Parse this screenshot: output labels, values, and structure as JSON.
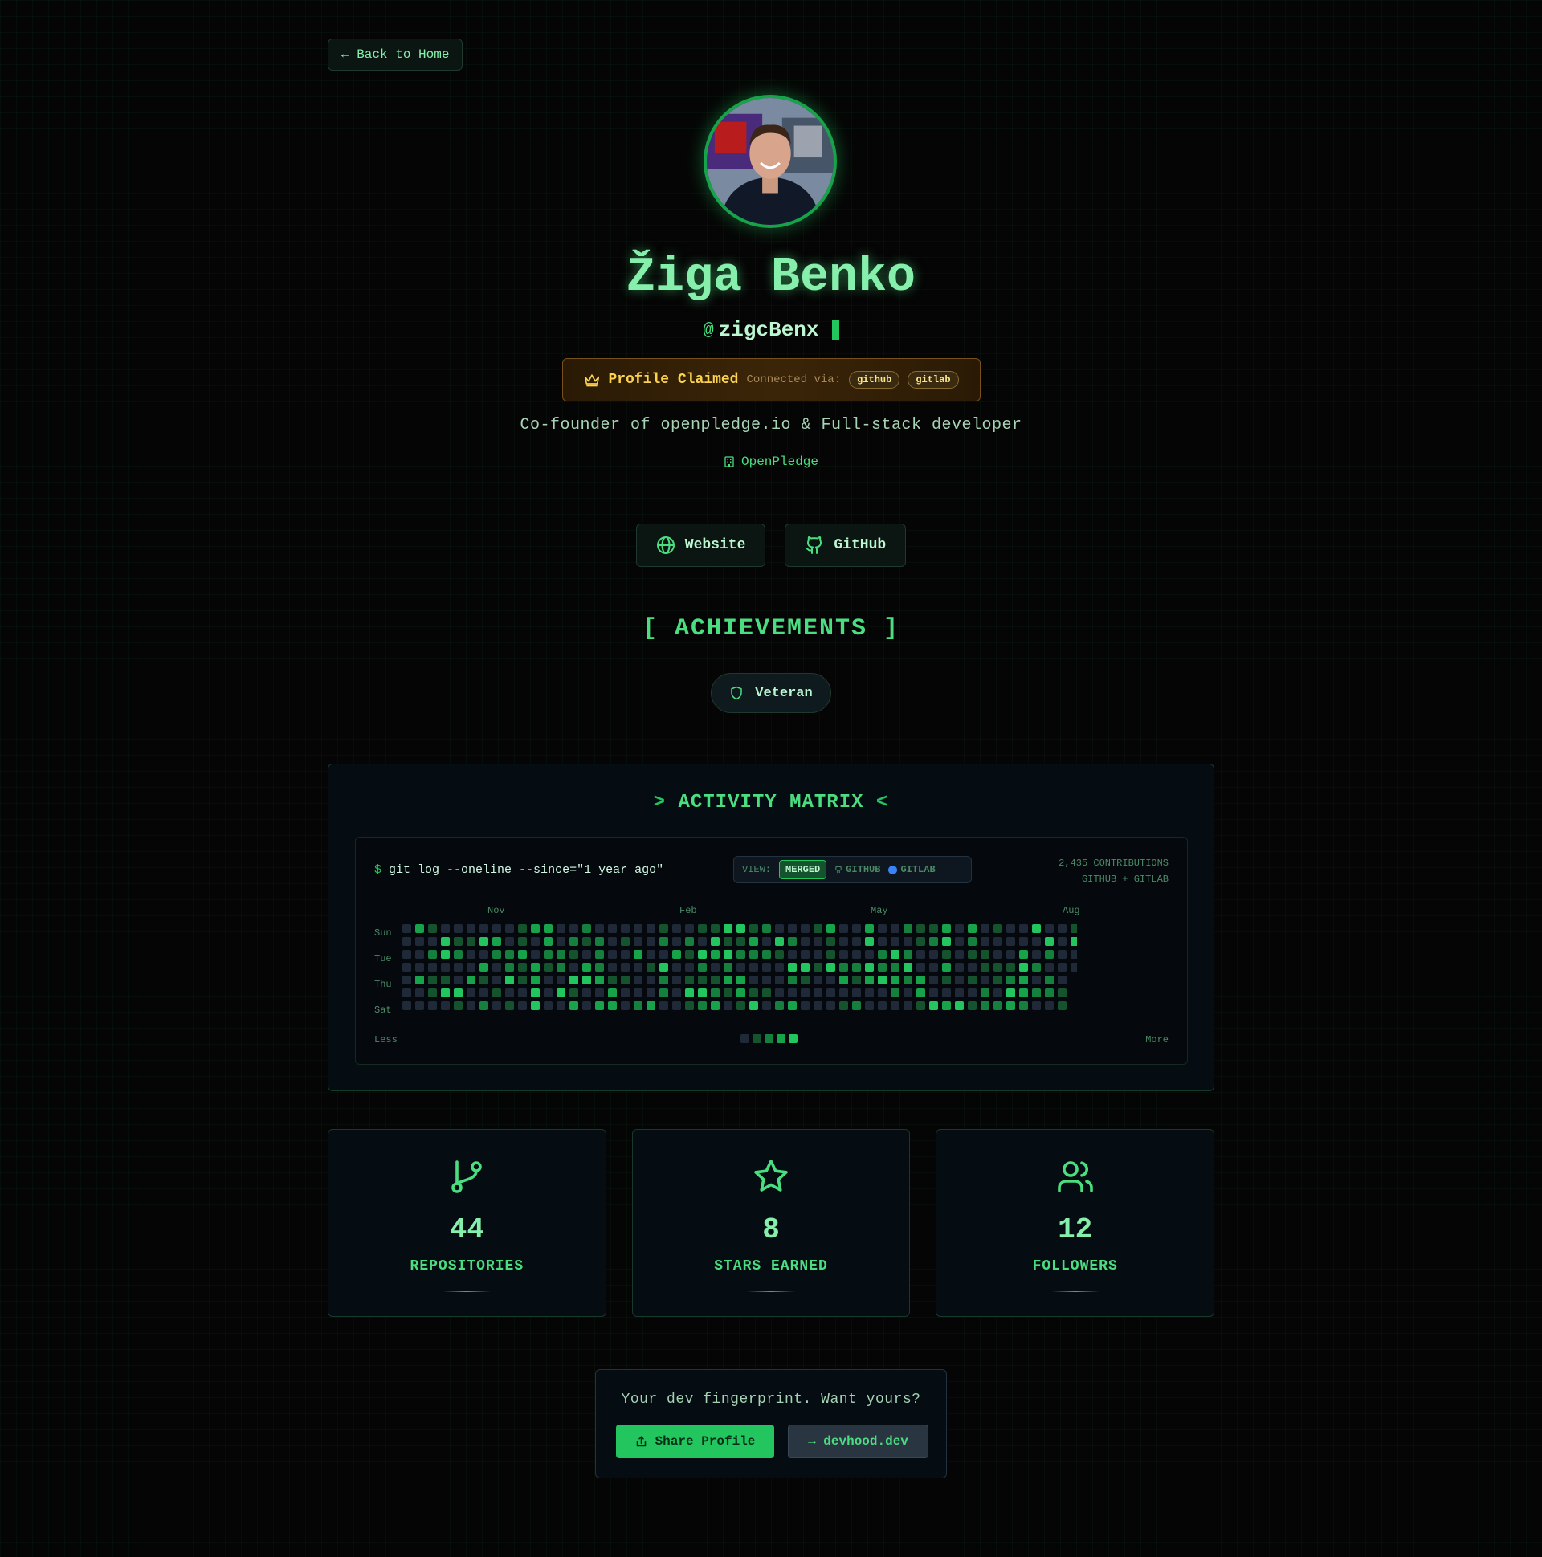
{
  "nav": {
    "back_label": "← Back to Home"
  },
  "profile": {
    "name": "Žiga Benko",
    "at": "@",
    "username": "zigcBenx",
    "claimed": {
      "title": "Profile Claimed",
      "via_label": "Connected via:",
      "providers": [
        "github",
        "gitlab"
      ]
    },
    "bio": "Co-founder of openpledge.io & Full-stack developer",
    "organization": "OpenPledge"
  },
  "links": [
    {
      "label": "Website",
      "icon": "globe-icon"
    },
    {
      "label": "GitHub",
      "icon": "github-icon"
    }
  ],
  "achievements": {
    "title": "[ ACHIEVEMENTS ]",
    "badges": [
      {
        "label": "Veteran",
        "icon": "shield-icon"
      }
    ]
  },
  "activity": {
    "title": "ACTIVITY MATRIX",
    "prefix": ">",
    "suffix": "<",
    "command_prompt": "$",
    "command": "git log --oneline --since=\"1 year ago\"",
    "view_label": "VIEW:",
    "view_options": [
      "MERGED",
      "GITHUB",
      "GITLAB"
    ],
    "view_selected": "MERGED",
    "contributions_line1": "2,435 CONTRIBUTIONS",
    "contributions_line2": "GITHUB + GITLAB",
    "months": [
      "Nov",
      "Feb",
      "May",
      "Aug"
    ],
    "day_labels": [
      "Sun",
      "Tue",
      "Thu",
      "Sat"
    ],
    "legend_less": "Less",
    "legend_more": "More",
    "level_colors": [
      "#1f2937",
      "#14532d",
      "#15803d",
      "#16a34a",
      "#22c55e"
    ]
  },
  "stats": [
    {
      "value": "44",
      "label": "REPOSITORIES",
      "icon": "git-branch-icon"
    },
    {
      "value": "8",
      "label": "STARS EARNED",
      "icon": "star-icon"
    },
    {
      "value": "12",
      "label": "FOLLOWERS",
      "icon": "users-icon"
    }
  ],
  "cta": {
    "question": "Your dev fingerprint. Want yours?",
    "share_label": "Share Profile",
    "site_label": "→ devhood.dev"
  },
  "colors": {
    "accent": "#22c55e",
    "accent_light": "#86efac",
    "gold": "#fcd34d",
    "background": "#050505"
  }
}
